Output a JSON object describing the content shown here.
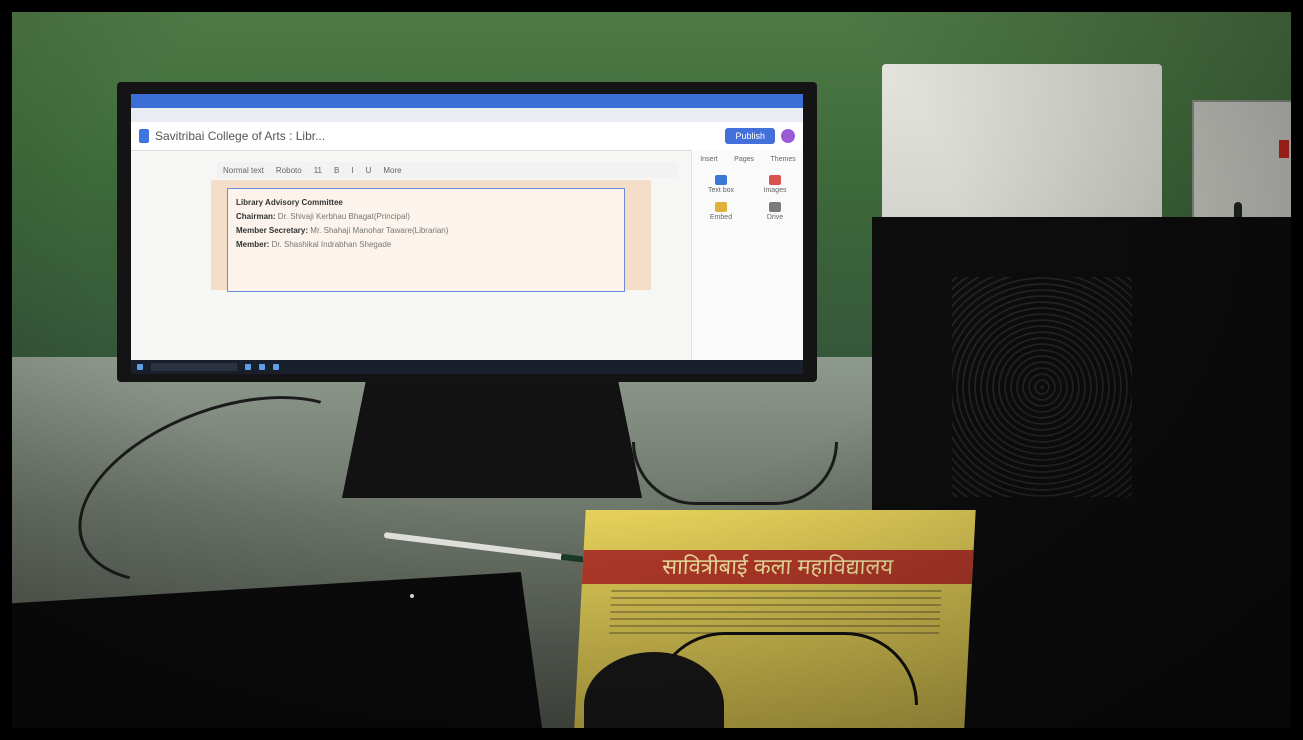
{
  "photo": {
    "description_icons": [
      "monitor-icon",
      "computer-tower-icon",
      "keyboard-icon",
      "mouse-icon",
      "book-icon",
      "pen-icon"
    ]
  },
  "screen": {
    "doc_title": "Savitribai College of Arts : Libr...",
    "toolbar": {
      "style": "Normal text",
      "font": "Roboto",
      "size": "11",
      "more": "More"
    },
    "publish_label": "Publish",
    "textbox": {
      "heading": "Library Advisory Committee",
      "chairman_label": "Chairman:",
      "chairman_value": "Dr. Shivaji Kerbhau Bhagat(Principal)",
      "secretary_label": "Member Secretary:",
      "secretary_value": "Mr. Shahaji Manohar Taware(Librarian)",
      "member_label": "Member:",
      "member_value": "Dr. Shashikal Indrabhan Shegade"
    },
    "side_panel": {
      "tabs": [
        "Insert",
        "Pages",
        "Themes"
      ],
      "items": [
        "Text box",
        "Images",
        "Embed",
        "Drive"
      ]
    }
  },
  "book": {
    "title": "सावित्रीबाई कला महाविद्यालय"
  },
  "colors": {
    "wall": "#4f7a47",
    "book_title_band": "#b43a2a",
    "publish_button": "#4470db"
  }
}
